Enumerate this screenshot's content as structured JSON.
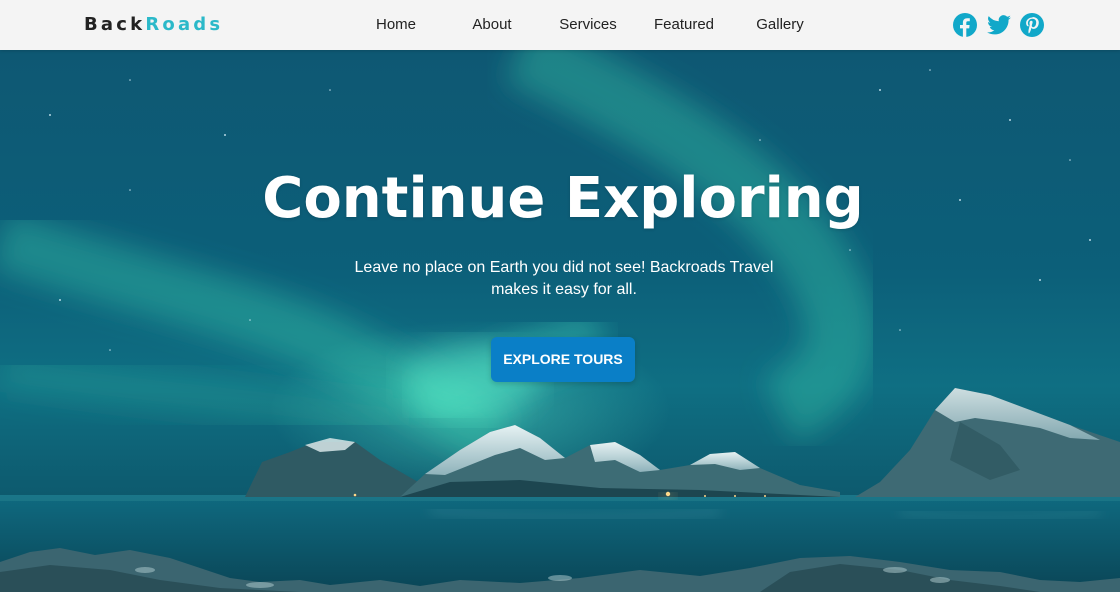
{
  "navbar": {
    "logo_part1": "Back",
    "logo_part2": "Roads",
    "links": [
      {
        "label": "Home"
      },
      {
        "label": "About"
      },
      {
        "label": "Services"
      },
      {
        "label": "Featured"
      },
      {
        "label": "Gallery"
      }
    ],
    "social": [
      {
        "icon": "facebook-icon"
      },
      {
        "icon": "twitter-icon"
      },
      {
        "icon": "pinterest-icon"
      }
    ]
  },
  "hero": {
    "title": "Continue Exploring",
    "subtitle": "Leave no place on Earth you did not see! Backroads Travel makes it easy for all.",
    "cta_label": "EXPLORE TOURS"
  },
  "colors": {
    "accent": "#2bb9c9",
    "social_icon": "#11a8c9",
    "cta_bg": "#0a7fc7",
    "navbar_bg": "#f4f4f4",
    "hero_tint": "#0c5f79"
  }
}
